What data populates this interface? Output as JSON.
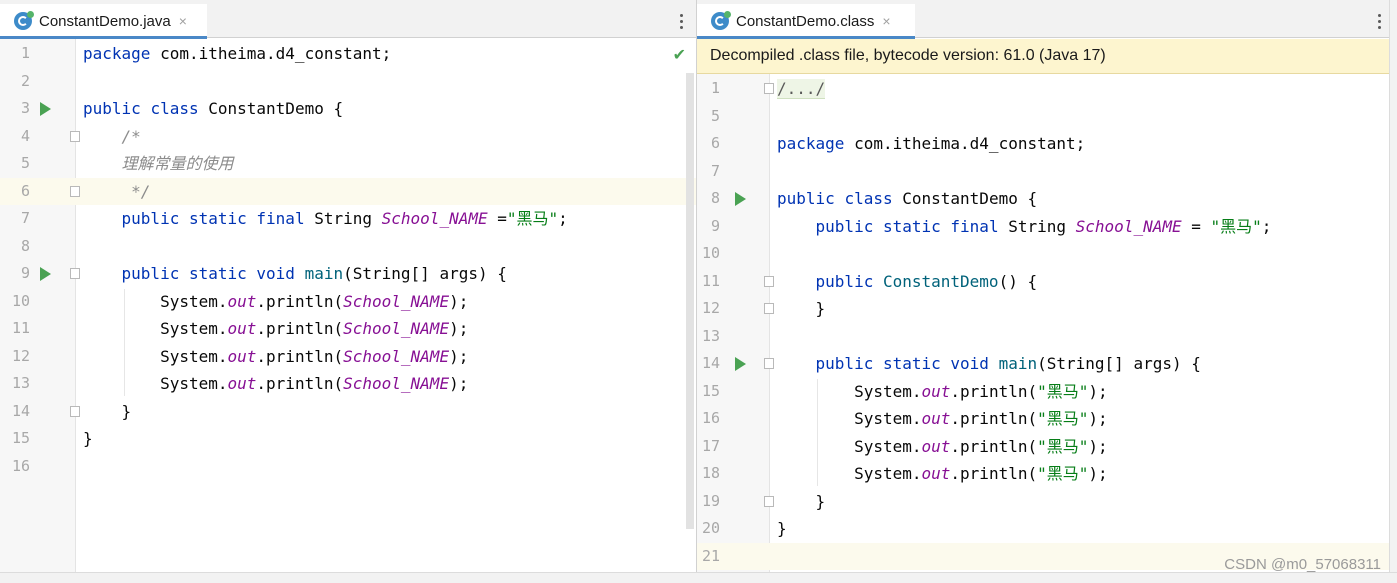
{
  "left": {
    "tab": {
      "icon": "java-class-icon",
      "label": "ConstantDemo.java",
      "close": "×"
    },
    "menu_icon": "kebab-menu-icon",
    "status_icon": "checkmark-icon",
    "lines": [
      {
        "n": "1",
        "tokens": [
          [
            "kw",
            "package"
          ],
          [
            "p",
            " com.itheima.d4_constant;"
          ]
        ]
      },
      {
        "n": "2",
        "tokens": []
      },
      {
        "n": "3",
        "run": true,
        "tokens": [
          [
            "kw",
            "public"
          ],
          [
            "p",
            " "
          ],
          [
            "kw",
            "class"
          ],
          [
            "p",
            " ConstantDemo {"
          ]
        ]
      },
      {
        "n": "4",
        "fold": true,
        "tokens": [
          [
            "cm",
            "    /*"
          ]
        ]
      },
      {
        "n": "5",
        "tokens": [
          [
            "cm",
            "    理解常量的使用"
          ]
        ]
      },
      {
        "n": "6",
        "fold": true,
        "current": true,
        "tokens": [
          [
            "cm",
            "     */"
          ]
        ]
      },
      {
        "n": "7",
        "tokens": [
          [
            "p",
            "    "
          ],
          [
            "kw",
            "public"
          ],
          [
            "p",
            " "
          ],
          [
            "kw",
            "static"
          ],
          [
            "p",
            " "
          ],
          [
            "kw",
            "final"
          ],
          [
            "p",
            " String "
          ],
          [
            "sf",
            "School_NAME"
          ],
          [
            "p",
            " ="
          ],
          [
            "str",
            "\"黑马\""
          ],
          [
            "p",
            ";"
          ]
        ]
      },
      {
        "n": "8",
        "tokens": []
      },
      {
        "n": "9",
        "run": true,
        "fold": true,
        "tokens": [
          [
            "p",
            "    "
          ],
          [
            "kw",
            "public"
          ],
          [
            "p",
            " "
          ],
          [
            "kw",
            "static"
          ],
          [
            "p",
            " "
          ],
          [
            "kw",
            "void"
          ],
          [
            "p",
            " "
          ],
          [
            "mt",
            "main"
          ],
          [
            "p",
            "(String[] args) {"
          ]
        ]
      },
      {
        "n": "10",
        "tokens": [
          [
            "p",
            "        System."
          ],
          [
            "sf",
            "out"
          ],
          [
            "p",
            ".println("
          ],
          [
            "sf",
            "School_NAME"
          ],
          [
            "p",
            ");"
          ]
        ]
      },
      {
        "n": "11",
        "tokens": [
          [
            "p",
            "        System."
          ],
          [
            "sf",
            "out"
          ],
          [
            "p",
            ".println("
          ],
          [
            "sf",
            "School_NAME"
          ],
          [
            "p",
            ");"
          ]
        ]
      },
      {
        "n": "12",
        "tokens": [
          [
            "p",
            "        System."
          ],
          [
            "sf",
            "out"
          ],
          [
            "p",
            ".println("
          ],
          [
            "sf",
            "School_NAME"
          ],
          [
            "p",
            ");"
          ]
        ]
      },
      {
        "n": "13",
        "tokens": [
          [
            "p",
            "        System."
          ],
          [
            "sf",
            "out"
          ],
          [
            "p",
            ".println("
          ],
          [
            "sf",
            "School_NAME"
          ],
          [
            "p",
            ");"
          ]
        ]
      },
      {
        "n": "14",
        "fold": true,
        "tokens": [
          [
            "p",
            "    }"
          ]
        ]
      },
      {
        "n": "15",
        "tokens": [
          [
            "p",
            "}"
          ]
        ]
      },
      {
        "n": "16",
        "tokens": []
      }
    ]
  },
  "right": {
    "tab": {
      "icon": "java-class-icon",
      "label": "ConstantDemo.class",
      "close": "×"
    },
    "menu_icon": "kebab-menu-icon",
    "banner": "Decompiled .class file, bytecode version: 61.0 (Java 17)",
    "lines": [
      {
        "n": "1",
        "fold": true,
        "tokens": [
          [
            "fold",
            "/.../"
          ]
        ]
      },
      {
        "n": "5",
        "tokens": []
      },
      {
        "n": "6",
        "tokens": [
          [
            "kw",
            "package"
          ],
          [
            "p",
            " com.itheima.d4_constant;"
          ]
        ]
      },
      {
        "n": "7",
        "tokens": []
      },
      {
        "n": "8",
        "run": true,
        "tokens": [
          [
            "kw",
            "public"
          ],
          [
            "p",
            " "
          ],
          [
            "kw",
            "class"
          ],
          [
            "p",
            " ConstantDemo {"
          ]
        ]
      },
      {
        "n": "9",
        "tokens": [
          [
            "p",
            "    "
          ],
          [
            "kw",
            "public"
          ],
          [
            "p",
            " "
          ],
          [
            "kw",
            "static"
          ],
          [
            "p",
            " "
          ],
          [
            "kw",
            "final"
          ],
          [
            "p",
            " String "
          ],
          [
            "sf",
            "School_NAME"
          ],
          [
            "p",
            " = "
          ],
          [
            "str",
            "\"黑马\""
          ],
          [
            "p",
            ";"
          ]
        ]
      },
      {
        "n": "10",
        "tokens": []
      },
      {
        "n": "11",
        "fold": true,
        "tokens": [
          [
            "p",
            "    "
          ],
          [
            "kw",
            "public"
          ],
          [
            "p",
            " "
          ],
          [
            "mt",
            "ConstantDemo"
          ],
          [
            "p",
            "() {"
          ]
        ]
      },
      {
        "n": "12",
        "fold": true,
        "tokens": [
          [
            "p",
            "    }"
          ]
        ]
      },
      {
        "n": "13",
        "tokens": []
      },
      {
        "n": "14",
        "run": true,
        "fold": true,
        "tokens": [
          [
            "p",
            "    "
          ],
          [
            "kw",
            "public"
          ],
          [
            "p",
            " "
          ],
          [
            "kw",
            "static"
          ],
          [
            "p",
            " "
          ],
          [
            "kw",
            "void"
          ],
          [
            "p",
            " "
          ],
          [
            "mt",
            "main"
          ],
          [
            "p",
            "(String[] args) {"
          ]
        ]
      },
      {
        "n": "15",
        "tokens": [
          [
            "p",
            "        System."
          ],
          [
            "sf",
            "out"
          ],
          [
            "p",
            ".println("
          ],
          [
            "str",
            "\"黑马\""
          ],
          [
            "p",
            ");"
          ]
        ]
      },
      {
        "n": "16",
        "tokens": [
          [
            "p",
            "        System."
          ],
          [
            "sf",
            "out"
          ],
          [
            "p",
            ".println("
          ],
          [
            "str",
            "\"黑马\""
          ],
          [
            "p",
            ");"
          ]
        ]
      },
      {
        "n": "17",
        "tokens": [
          [
            "p",
            "        System."
          ],
          [
            "sf",
            "out"
          ],
          [
            "p",
            ".println("
          ],
          [
            "str",
            "\"黑马\""
          ],
          [
            "p",
            ");"
          ]
        ]
      },
      {
        "n": "18",
        "tokens": [
          [
            "p",
            "        System."
          ],
          [
            "sf",
            "out"
          ],
          [
            "p",
            ".println("
          ],
          [
            "str",
            "\"黑马\""
          ],
          [
            "p",
            ");"
          ]
        ]
      },
      {
        "n": "19",
        "fold": true,
        "tokens": [
          [
            "p",
            "    }"
          ]
        ]
      },
      {
        "n": "20",
        "tokens": [
          [
            "p",
            "}"
          ]
        ]
      },
      {
        "n": "21",
        "current": true,
        "tokens": []
      }
    ]
  },
  "watermark": "CSDN @m0_57068311",
  "colors": {
    "keyword": "#0033b3",
    "static_field": "#871094",
    "string": "#067d17",
    "comment": "#8c8c8c",
    "method": "#00627a",
    "run_icon": "#4aa253",
    "banner_bg": "#fdf5cf",
    "current_line": "#fcfaed",
    "tab_underline": "#4a88c7"
  }
}
